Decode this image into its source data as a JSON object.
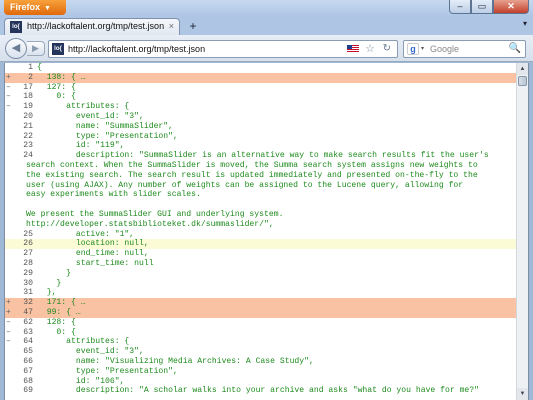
{
  "browser": {
    "menu_label": "Firefox",
    "menu_arrow": "▼",
    "window_buttons": {
      "minimize": "–",
      "maximize": "▭",
      "close": "✕"
    }
  },
  "tab": {
    "title": "http://lackoftalent.org/tmp/test.json",
    "close": "×",
    "new_tab": "+",
    "list_arrow": "▾"
  },
  "nav": {
    "back": "◀",
    "forward": "▶",
    "url": "http://lackoftalent.org/tmp/test.json",
    "star": "☆",
    "refresh": "↻",
    "search_placeholder": "Google",
    "search_engine_letter": "g",
    "search_drop": "▾",
    "search_icon": "🔍"
  },
  "favicon_text": "lo{",
  "colors": {
    "highlight_collapsed": "#f9c2a3",
    "highlight_hover": "#fbfbd6",
    "json_text": "#1e8a1e"
  },
  "icons": [
    "firefox-menu-icon",
    "favicon-icon",
    "flag-icon",
    "star-icon",
    "refresh-icon",
    "google-icon",
    "search-icon",
    "back-icon",
    "forward-icon"
  ],
  "json_lines": [
    {
      "toggle": "",
      "num": "1",
      "code": "{",
      "hl": ""
    },
    {
      "toggle": "+",
      "num": "2",
      "code": "  138: { …",
      "hl": "orange"
    },
    {
      "toggle": "–",
      "num": "17",
      "code": "  127: {",
      "hl": ""
    },
    {
      "toggle": "–",
      "num": "18",
      "code": "    0: {",
      "hl": ""
    },
    {
      "toggle": "–",
      "num": "19",
      "code": "      attributes: {",
      "hl": ""
    },
    {
      "toggle": "",
      "num": "20",
      "code": "        event_id: \"3\",",
      "hl": ""
    },
    {
      "toggle": "",
      "num": "21",
      "code": "        name: \"SummaSlider\",",
      "hl": ""
    },
    {
      "toggle": "",
      "num": "22",
      "code": "        type: \"Presentation\",",
      "hl": ""
    },
    {
      "toggle": "",
      "num": "23",
      "code": "        id: \"119\",",
      "hl": ""
    },
    {
      "toggle": "",
      "num": "24",
      "code": "        description: \"SummaSlider is an alternative way to make search results fit the user's",
      "hl": ""
    },
    {
      "toggle": "",
      "num": "",
      "code": "search context. When the SummaSlider is moved, the Summa search system assigns new weights to",
      "hl": "",
      "wrap": true
    },
    {
      "toggle": "",
      "num": "",
      "code": "the existing search. The search result is updated immediately and presented on-the-fly to the",
      "hl": "",
      "wrap": true
    },
    {
      "toggle": "",
      "num": "",
      "code": "user (using AJAX). Any number of weights can be assigned to the Lucene query, allowing for",
      "hl": "",
      "wrap": true
    },
    {
      "toggle": "",
      "num": "",
      "code": "easy experiments with slider scales.",
      "hl": "",
      "wrap": true
    },
    {
      "toggle": "",
      "num": "",
      "code": "",
      "hl": "",
      "wrap": true
    },
    {
      "toggle": "",
      "num": "",
      "code": "We present the SummaSlider GUI and underlying system.",
      "hl": "",
      "wrap": true
    },
    {
      "toggle": "",
      "num": "",
      "code": "http://developer.statsbiblioteket.dk/summaslider/\",",
      "hl": "",
      "wrap": true
    },
    {
      "toggle": "",
      "num": "25",
      "code": "        active: \"1\",",
      "hl": ""
    },
    {
      "toggle": "",
      "num": "26",
      "code": "        location: null,",
      "hl": "yellow"
    },
    {
      "toggle": "",
      "num": "27",
      "code": "        end_time: null,",
      "hl": ""
    },
    {
      "toggle": "",
      "num": "28",
      "code": "        start_time: null",
      "hl": ""
    },
    {
      "toggle": "",
      "num": "29",
      "code": "      }",
      "hl": ""
    },
    {
      "toggle": "",
      "num": "30",
      "code": "    }",
      "hl": ""
    },
    {
      "toggle": "",
      "num": "31",
      "code": "  },",
      "hl": ""
    },
    {
      "toggle": "+",
      "num": "32",
      "code": "  171: { …",
      "hl": "orange"
    },
    {
      "toggle": "+",
      "num": "47",
      "code": "  99: { …",
      "hl": "orange"
    },
    {
      "toggle": "–",
      "num": "62",
      "code": "  128: {",
      "hl": ""
    },
    {
      "toggle": "–",
      "num": "63",
      "code": "    0: {",
      "hl": ""
    },
    {
      "toggle": "–",
      "num": "64",
      "code": "      attributes: {",
      "hl": ""
    },
    {
      "toggle": "",
      "num": "65",
      "code": "        event_id: \"3\",",
      "hl": ""
    },
    {
      "toggle": "",
      "num": "66",
      "code": "        name: \"Visualizing Media Archives: A Case Study\",",
      "hl": ""
    },
    {
      "toggle": "",
      "num": "67",
      "code": "        type: \"Presentation\",",
      "hl": ""
    },
    {
      "toggle": "",
      "num": "68",
      "code": "        id: \"106\",",
      "hl": ""
    },
    {
      "toggle": "",
      "num": "69",
      "code": "        description: \"A scholar walks into your archive and asks \"what do you have for me?\"",
      "hl": ""
    }
  ]
}
